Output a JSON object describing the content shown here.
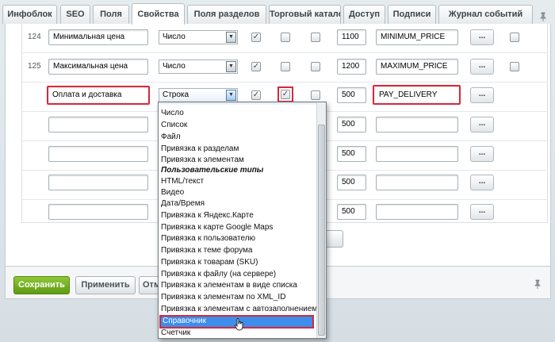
{
  "tabs": [
    "Инфоблок",
    "SEO",
    "Поля",
    "Свойства",
    "Поля разделов",
    "Торговый каталог",
    "Доступ",
    "Подписи",
    "Журнал событий"
  ],
  "active_tab": "Свойства",
  "rows": [
    {
      "id": "124",
      "name": "Минимальная цена",
      "type": "Число",
      "sort": "1100",
      "code": "MINIMUM_PRICE",
      "active": true,
      "multiple": false,
      "required": false,
      "searchable": true
    },
    {
      "id": "125",
      "name": "Максимальная цена",
      "type": "Число",
      "sort": "1200",
      "code": "MAXIMUM_PRICE",
      "active": true,
      "multiple": false,
      "required": false,
      "searchable": false
    },
    {
      "id": "",
      "name": "Оплата и доставка",
      "type": "Строка",
      "sort": "500",
      "code": "PAY_DELIVERY",
      "active": true,
      "multiple": true,
      "required": false
    }
  ],
  "empty_sort": "500",
  "more_button": "...",
  "dropdown": {
    "items": [
      "Число",
      "Список",
      "Файл",
      "Привязка к разделам",
      "Привязка к элементам",
      "Пользовательские типы",
      "HTML/текст",
      "Видео",
      "Дата/Время",
      "Привязка к Яндекс.Карте",
      "Привязка к карте Google Maps",
      "Привязка к пользователю",
      "Привязка к теме форума",
      "Привязка к товарам (SKU)",
      "Привязка к файлу (на сервере)",
      "Привязка к элементам в виде списка",
      "Привязка к элементам по XML_ID",
      "Привязка к элементам с автозаполнением",
      "Справочник",
      "Счетчик"
    ],
    "selected": "Справочник",
    "group_label": "Пользовательские типы"
  },
  "buttons": {
    "save": "Сохранить",
    "apply": "Применить",
    "cancel": "Отм"
  },
  "colors": {
    "highlight": "#d8283a",
    "selected": "#3c8eea",
    "save": "#6fae1f"
  }
}
